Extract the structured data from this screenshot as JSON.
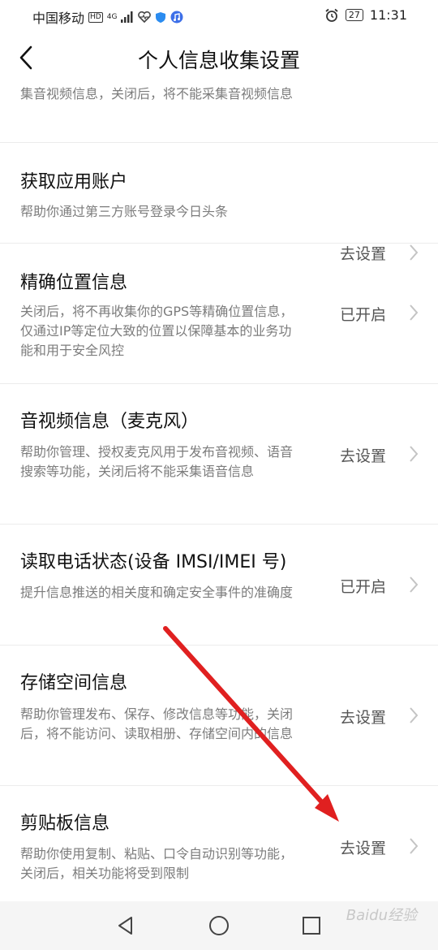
{
  "status_bar": {
    "carrier": "中国移动",
    "hd": "HD",
    "network": "4G",
    "battery": "27",
    "time": "11:31"
  },
  "header": {
    "title": "个人信息收集设置",
    "back_icon": "chevron-left-icon"
  },
  "partial_item": {
    "description": "集音视频信息，关闭后，将不能采集音视频信息"
  },
  "items": [
    {
      "title": "获取应用账户",
      "description": "帮助你通过第三方账号登录今日头条",
      "action": "去设置"
    },
    {
      "title": "精确位置信息",
      "description": "关闭后，将不再收集你的GPS等精确位置信息，仅通过IP等定位大致的位置以保障基本的业务功能和用于安全风控",
      "action": "已开启"
    },
    {
      "title": "音视频信息（麦克风）",
      "description": "帮助你管理、授权麦克风用于发布音视频、语音搜索等功能，关闭后将不能采集语音信息",
      "action": "去设置"
    },
    {
      "title": "读取电话状态(设备 IMSI/IMEI 号)",
      "description": "提升信息推送的相关度和确定安全事件的准确度",
      "action": "已开启"
    },
    {
      "title": "存储空间信息",
      "description": "帮助你管理发布、保存、修改信息等功能，关闭后，将不能访问、读取相册、存储空间内的信息",
      "action": "去设置"
    },
    {
      "title": "剪贴板信息",
      "description": "帮助你使用复制、粘贴、口令自动识别等功能，关闭后，相关功能将受到限制",
      "action": "去设置"
    }
  ],
  "nav_bar": {
    "back": "triangle-back-icon",
    "home": "circle-home-icon",
    "recent": "square-recent-icon"
  },
  "watermark": "Baidu经验",
  "colors": {
    "arrow": "#e02020",
    "secondary_text": "#7c7c7c",
    "divider": "#ececec"
  }
}
